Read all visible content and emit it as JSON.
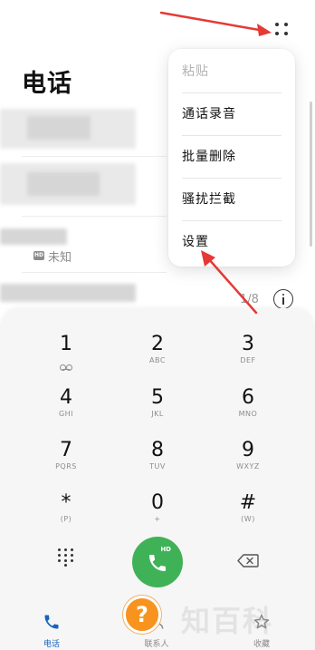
{
  "header": {
    "title": "电话"
  },
  "call_list": {
    "unknown_label": "未知",
    "hd_tag": "HD",
    "count": "1/8"
  },
  "menu": {
    "items": [
      {
        "label": "粘贴",
        "enabled": false
      },
      {
        "label": "通话录音",
        "enabled": true
      },
      {
        "label": "批量删除",
        "enabled": true
      },
      {
        "label": "骚扰拦截",
        "enabled": true
      },
      {
        "label": "设置",
        "enabled": true
      }
    ]
  },
  "dialpad": {
    "keys": [
      {
        "digit": "1",
        "sub": ""
      },
      {
        "digit": "2",
        "sub": "ABC"
      },
      {
        "digit": "3",
        "sub": "DEF"
      },
      {
        "digit": "4",
        "sub": "GHI"
      },
      {
        "digit": "5",
        "sub": "JKL"
      },
      {
        "digit": "6",
        "sub": "MNO"
      },
      {
        "digit": "7",
        "sub": "PQRS"
      },
      {
        "digit": "8",
        "sub": "TUV"
      },
      {
        "digit": "9",
        "sub": "WXYZ"
      },
      {
        "digit": "*",
        "sub": "(P)"
      },
      {
        "digit": "0",
        "sub": "+"
      },
      {
        "digit": "#",
        "sub": "(W)"
      }
    ],
    "call_badge": "HD"
  },
  "tabs": [
    {
      "label": "电话",
      "active": true,
      "icon": "phone-icon"
    },
    {
      "label": "联系人",
      "active": false,
      "icon": "contacts-icon"
    },
    {
      "label": "收藏",
      "active": false,
      "icon": "favorites-icon"
    }
  ],
  "overlay": {
    "help_mark": "?",
    "watermark": "知百科"
  },
  "colors": {
    "accent": "#1565c0",
    "call_green": "#3fb257",
    "annotation_red": "#e53935",
    "help_orange": "#f7931e"
  }
}
